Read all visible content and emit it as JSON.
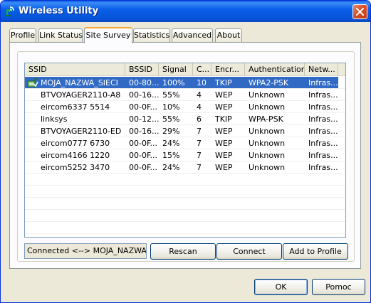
{
  "window": {
    "title": "Wireless Utility",
    "icon": "wireless-utility-icon"
  },
  "tabs": [
    {
      "label": "Profile"
    },
    {
      "label": "Link Status"
    },
    {
      "label": "Site Survey",
      "active": true
    },
    {
      "label": "Statistics"
    },
    {
      "label": "Advanced"
    },
    {
      "label": "About"
    }
  ],
  "list": {
    "columns": [
      "SSID",
      "BSSID",
      "Signal",
      "C...",
      "Encr...",
      "Authentication",
      "Netw..."
    ],
    "rows": [
      {
        "ssid": "MOJA_NAZWA_SIECI",
        "bssid": "00-80...",
        "signal": "100%",
        "channel": "10",
        "encryption": "TKIP",
        "auth": "WPA2-PSK",
        "network": "Infras...",
        "selected": true,
        "connected": true
      },
      {
        "ssid": "BTVOYAGER2110-A8",
        "bssid": "00-16...",
        "signal": "55%",
        "channel": "4",
        "encryption": "WEP",
        "auth": "Unknown",
        "network": "Infras..."
      },
      {
        "ssid": "eircom6337 5514",
        "bssid": "00-0F...",
        "signal": "10%",
        "channel": "4",
        "encryption": "WEP",
        "auth": "Unknown",
        "network": "Infras..."
      },
      {
        "ssid": "linksys",
        "bssid": "00-12...",
        "signal": "55%",
        "channel": "6",
        "encryption": "TKIP",
        "auth": "WPA-PSK",
        "network": "Infras..."
      },
      {
        "ssid": "BTVOYAGER2110-ED",
        "bssid": "00-16...",
        "signal": "29%",
        "channel": "7",
        "encryption": "WEP",
        "auth": "Unknown",
        "network": "Infras..."
      },
      {
        "ssid": "eircom0777 6730",
        "bssid": "00-0F...",
        "signal": "24%",
        "channel": "7",
        "encryption": "WEP",
        "auth": "Unknown",
        "network": "Infras..."
      },
      {
        "ssid": "eircom4166 1220",
        "bssid": "00-0F...",
        "signal": "15%",
        "channel": "7",
        "encryption": "WEP",
        "auth": "Unknown",
        "network": "Infras..."
      },
      {
        "ssid": "eircom5252 3470",
        "bssid": "00-0F...",
        "signal": "24%",
        "channel": "7",
        "encryption": "WEP",
        "auth": "Unknown",
        "network": "Infras..."
      }
    ]
  },
  "status": {
    "connection_text": "Connected <--> MOJA_NAZWA_SI"
  },
  "buttons": {
    "rescan": "Rescan",
    "connect": "Connect",
    "add_to_profile": "Add to Profile",
    "ok": "OK",
    "help": "Pomoc"
  },
  "colors": {
    "title_bar": "#0a5fe8",
    "selection": "#316ac5",
    "dialog_face": "#ece9d8",
    "active_tab_accent": "#f4a534",
    "close_button": "#d8502a"
  }
}
